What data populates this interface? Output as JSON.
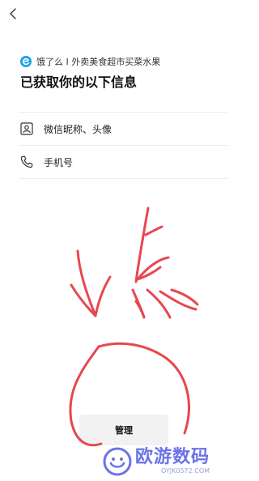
{
  "header": {
    "back_icon": "chevron-left-icon",
    "app_name": "饿了么 I 外卖美食超市买菜水果",
    "app_logo_icon": "eleme-logo-icon",
    "title": "已获取你的以下信息"
  },
  "permissions": [
    {
      "icon": "profile-card-icon",
      "label": "微信昵称、头像"
    },
    {
      "icon": "phone-icon",
      "label": "手机号"
    }
  ],
  "footer": {
    "manage_label": "管理"
  },
  "annotation": {
    "color": "#e8474f"
  },
  "watermark": {
    "title": "欧游数码",
    "subtitle": "OYJK0572.COM",
    "color": "#6a73e8"
  },
  "colors": {
    "brand": "#1aa3e8",
    "annotation": "#e8474f"
  }
}
